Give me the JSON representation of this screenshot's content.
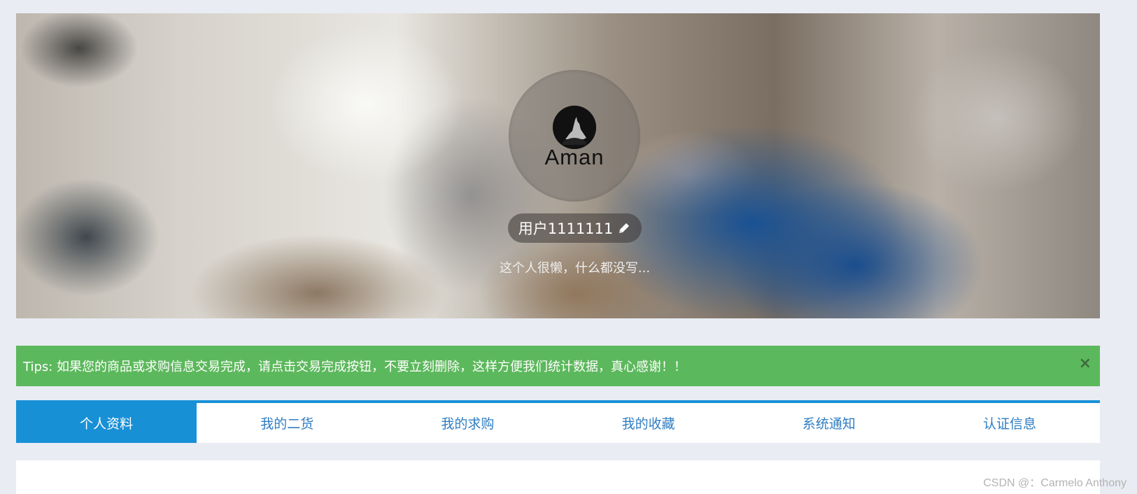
{
  "profile": {
    "avatar_text": "Aman",
    "username": "用户1111111",
    "bio": "这个人很懒，什么都没写..."
  },
  "tips": {
    "text": "Tips: 如果您的商品或求购信息交易完成，请点击交易完成按钮，不要立刻删除，这样方便我们统计数据，真心感谢！！",
    "close_label": "×"
  },
  "tabs": [
    {
      "label": "个人资料",
      "active": true
    },
    {
      "label": "我的二货",
      "active": false
    },
    {
      "label": "我的求购",
      "active": false
    },
    {
      "label": "我的收藏",
      "active": false
    },
    {
      "label": "系统通知",
      "active": false
    },
    {
      "label": "认证信息",
      "active": false
    }
  ],
  "watermark": "CSDN @：Carmelo Anthony",
  "colors": {
    "page_bg": "#e9ecf3",
    "accent": "#1890d6",
    "tips_bg": "#5cb85c",
    "tab_text": "#2f7dc2"
  },
  "icons": {
    "edit": "pencil-icon",
    "avatar_logo": "wolf-logo-icon"
  }
}
